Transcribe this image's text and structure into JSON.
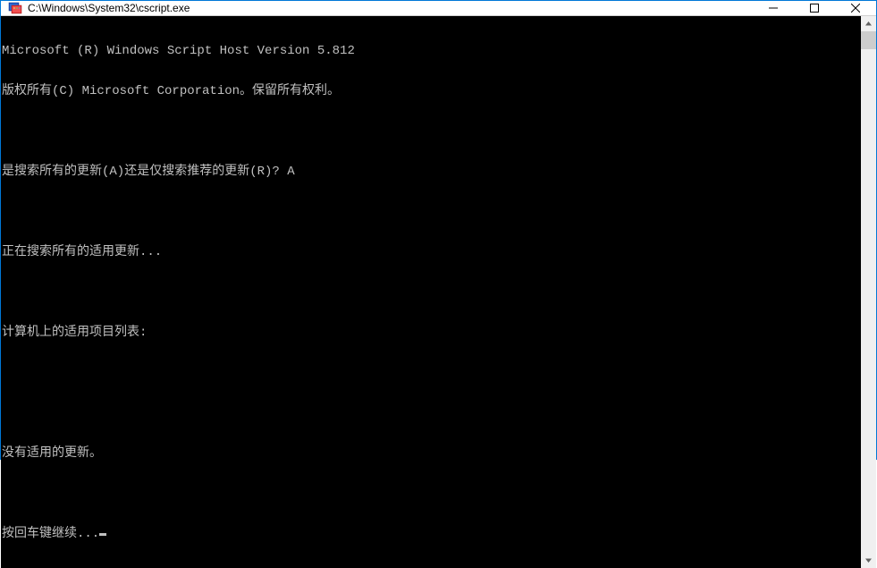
{
  "titlebar": {
    "title": "C:\\Windows\\System32\\cscript.exe"
  },
  "console": {
    "lines": [
      "Microsoft (R) Windows Script Host Version 5.812",
      "版权所有(C) Microsoft Corporation。保留所有权利。",
      "",
      "是搜索所有的更新(A)还是仅搜索推荐的更新(R)? A",
      "",
      "正在搜索所有的适用更新...",
      "",
      "计算机上的适用项目列表:",
      "",
      "",
      "没有适用的更新。",
      "",
      "按回车键继续..."
    ]
  }
}
